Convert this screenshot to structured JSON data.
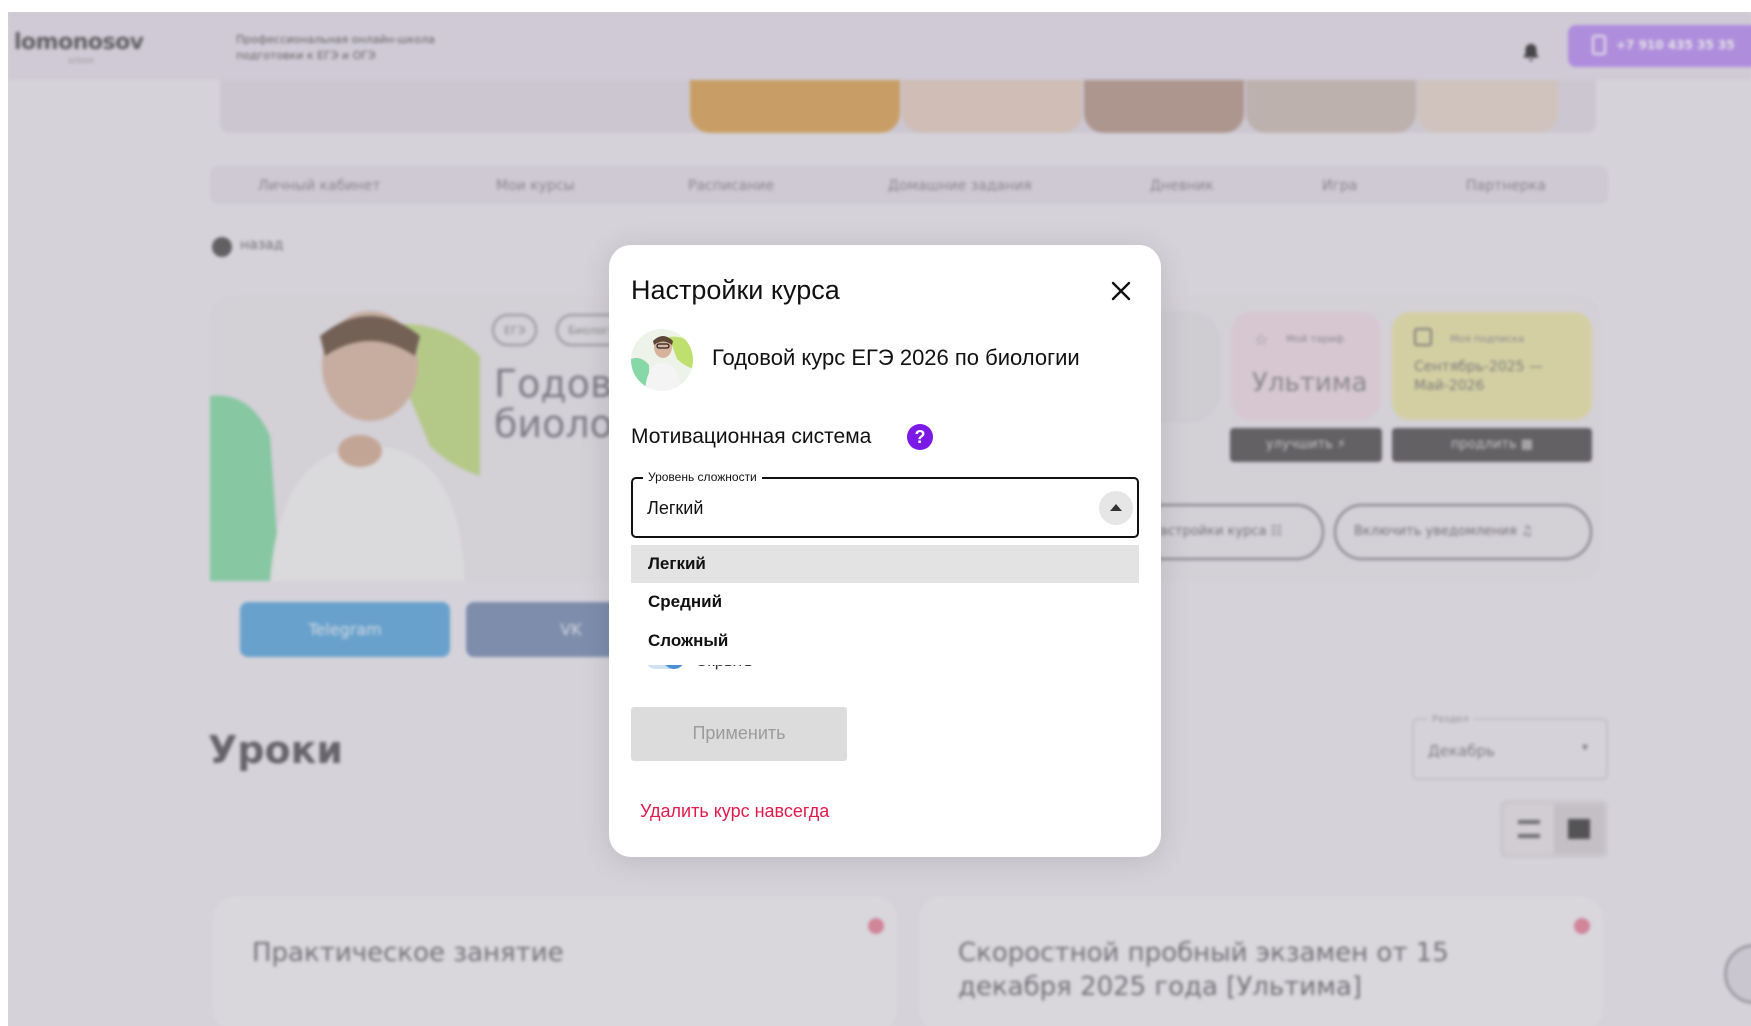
{
  "header": {
    "logo": "lomonosov",
    "logo_sub": "school",
    "tagline": "Профессиональная онлайн-школа подготовки к ЕГЭ и ОГЭ",
    "phone": "+7 910 435 35 35"
  },
  "nav": {
    "items": [
      {
        "label": "Личный кабинет"
      },
      {
        "label": "Мои курсы"
      },
      {
        "label": "Расписание"
      },
      {
        "label": "Домашние задания"
      },
      {
        "label": "Дневник"
      },
      {
        "label": "Игра"
      },
      {
        "label": "Партнерка"
      }
    ]
  },
  "back": {
    "label": "назад"
  },
  "course_card": {
    "tags": [
      "ЕГЭ",
      "Биология"
    ],
    "title_line1": "Годовой курс ЕГЭ 2026 по",
    "title_line2": "биологии",
    "tariff_label": "Мой тариф",
    "tariff_value": "Ультима",
    "subscription_label": "Моя подписка",
    "subscription_value": "Сентябрь-2025 — Май-2026",
    "upgrade_label": "улучшить",
    "extend_label": "продлить",
    "settings_label": "Настройки курса",
    "notifications_label": "Включить уведомления"
  },
  "social": {
    "telegram": "Telegram",
    "vk": "VK"
  },
  "lessons": {
    "title": "Уроки",
    "section_label": "Раздел",
    "section_value": "Декабрь",
    "cards": [
      {
        "title": "Практическое занятие"
      },
      {
        "title": "Скоростной пробный экзамен от 15 декабря 2025 года [Ультима]"
      }
    ]
  },
  "modal": {
    "title": "Настройки курса",
    "course_name": "Годовой курс ЕГЭ 2026 по биологии",
    "motivation_label": "Мотивационная система",
    "help_icon": "?",
    "difficulty": {
      "legend": "Уровень сложности",
      "value": "Легкий",
      "options": [
        "Легкий",
        "Средний",
        "Сложный"
      ],
      "selected_index": 0
    },
    "toggle_label": "Скрыть",
    "apply_label": "Применить",
    "delete_label": "Удалить курс навсегда"
  },
  "colors": {
    "accent_purple": "#7b19e6",
    "delete_red": "#e21a4c",
    "apply_disabled": "#dcdcdc"
  }
}
